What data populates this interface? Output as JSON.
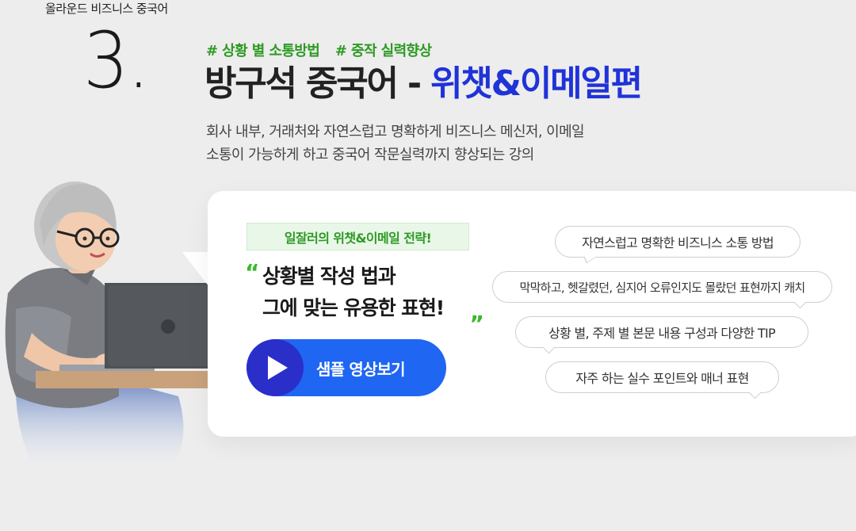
{
  "top_label": "올라운드 비즈니스 중국어",
  "section_number": "3.",
  "tags": [
    "# 상황 별 소통방법",
    "# 중작 실력향상"
  ],
  "headline": {
    "main": "방구석 중국어 - ",
    "accent": "위챗&이메일편"
  },
  "description": {
    "line1": "회사 내부, 거래처와 자연스럽고 명확하게 비즈니스 메신저, 이메일",
    "line2": "소통이 가능하게 하고 중국어 작문실력까지 향상되는 강의"
  },
  "card": {
    "badge": "일잘러의 위챗&이메일 전략!",
    "quote_open": "“",
    "quote_close": "„",
    "quote_line1": "상황별 작성 법과",
    "quote_line2": "그에 맞는 유용한 표현!",
    "play_button": "샘플 영상보기"
  },
  "bubbles": [
    "자연스럽고 명확한 비즈니스 소통 방법",
    "막막하고, 헷갈렸던, 심지어 오류인지도 몰랐던 표현까지 캐치",
    "상황 별, 주제 별 본문 내용 구성과 다양한 TIP",
    "자주 하는 실수 포인트와 매너 표현"
  ],
  "colors": {
    "accent_blue": "#2033d8",
    "tag_green": "#2d9a23",
    "button_blue": "#1f66f2",
    "background": "#ededed"
  },
  "icons": {
    "play": "play-icon",
    "illustration": "person-with-laptop"
  }
}
